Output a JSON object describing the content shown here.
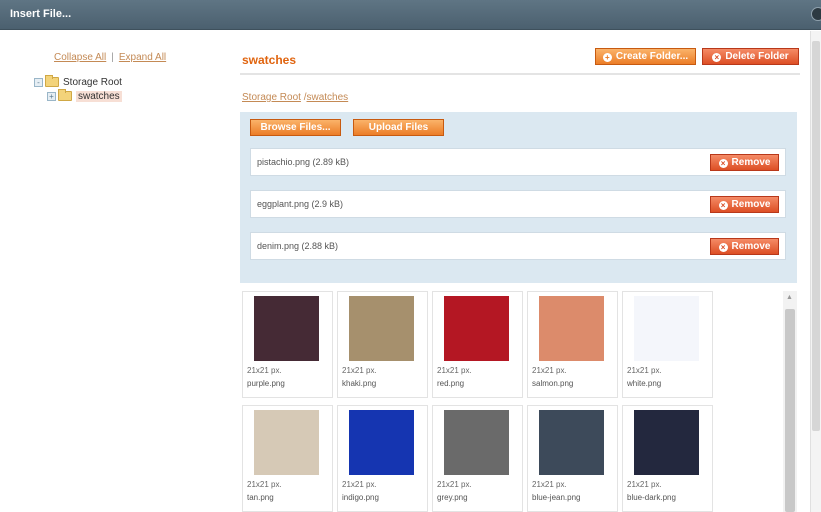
{
  "window": {
    "title": "Insert File..."
  },
  "tree": {
    "collapse_all": "Collapse All",
    "separator": "|",
    "expand_all": "Expand All",
    "nodes": [
      {
        "label": "Storage Root",
        "toggle": "-"
      },
      {
        "label": "swatches",
        "toggle": "+",
        "selected": true
      }
    ]
  },
  "main": {
    "title": "swatches",
    "create_folder": "Create Folder...",
    "delete_folder": "Delete Folder",
    "breadcrumb": {
      "root": "Storage Root",
      "divider": "/",
      "current": "swatches"
    },
    "upload": {
      "browse": "Browse Files...",
      "upload": "Upload Files",
      "remove_label": "Remove",
      "files": [
        {
          "name": "pistachio.png (2.89 kB)"
        },
        {
          "name": "eggplant.png (2.9 kB)"
        },
        {
          "name": "denim.png (2.88 kB)"
        }
      ]
    },
    "thumbnails": [
      {
        "dim": "21x21 px.",
        "name": "purple.png",
        "color": "#452a35"
      },
      {
        "dim": "21x21 px.",
        "name": "khaki.png",
        "color": "#a6906d"
      },
      {
        "dim": "21x21 px.",
        "name": "red.png",
        "color": "#b41723"
      },
      {
        "dim": "21x21 px.",
        "name": "salmon.png",
        "color": "#dc8b6b"
      },
      {
        "dim": "21x21 px.",
        "name": "white.png",
        "color": "#f4f6fb"
      },
      {
        "dim": "21x21 px.",
        "name": "tan.png",
        "color": "#d6c9b6"
      },
      {
        "dim": "21x21 px.",
        "name": "indigo.png",
        "color": "#1535b1"
      },
      {
        "dim": "21x21 px.",
        "name": "grey.png",
        "color": "#6a6a6a"
      },
      {
        "dim": "21x21 px.",
        "name": "blue-jean.png",
        "color": "#3d4a5a"
      },
      {
        "dim": "21x21 px.",
        "name": "blue-dark.png",
        "color": "#23283e"
      }
    ]
  },
  "colors": {
    "accent": "#e0640f",
    "panel": "#dbe8f1",
    "titlebar": "#55697a"
  },
  "icons": {
    "folder": "folder-icon",
    "plus": "plus-icon",
    "remove": "remove-icon"
  }
}
